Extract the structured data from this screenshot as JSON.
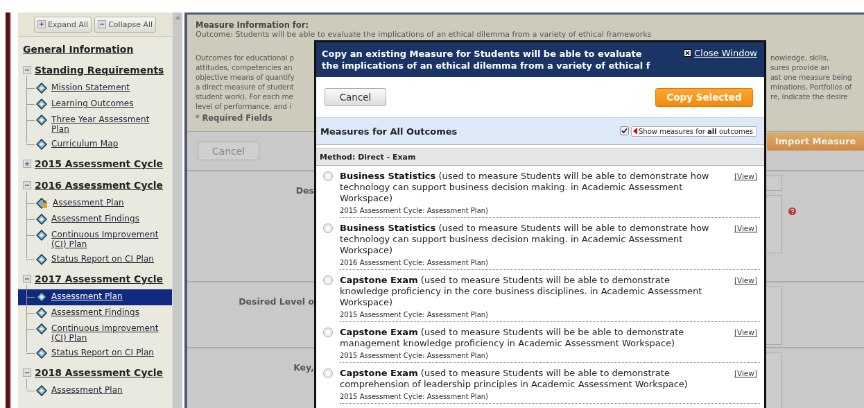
{
  "sidebar": {
    "buttons": [
      {
        "label": "Expand All",
        "kind": "expand"
      },
      {
        "label": "Collapse All",
        "kind": "collapse"
      }
    ],
    "items": [
      {
        "label": "General Information",
        "kind": "link"
      },
      {
        "label": "Standing Requirements",
        "kind": "group",
        "expanded": true,
        "children": [
          {
            "label": "Mission Statement",
            "locked": false,
            "selected": false
          },
          {
            "label": "Learning Outcomes",
            "locked": false,
            "selected": false
          },
          {
            "label": "Three Year Assessment Plan",
            "locked": false,
            "selected": false
          },
          {
            "label": "Curriculum Map",
            "locked": false,
            "selected": false
          }
        ]
      },
      {
        "label": "2015 Assessment Cycle",
        "kind": "group",
        "expanded": false
      },
      {
        "label": "2016 Assessment Cycle",
        "kind": "group",
        "expanded": true,
        "children": [
          {
            "label": "Assessment Plan",
            "locked": true,
            "selected": false
          },
          {
            "label": "Assessment Findings",
            "locked": false,
            "selected": false
          },
          {
            "label": "Continuous Improvement (CI) Plan",
            "locked": false,
            "selected": false
          },
          {
            "label": "Status Report on CI Plan",
            "locked": false,
            "selected": false
          }
        ]
      },
      {
        "label": "2017 Assessment Cycle",
        "kind": "group",
        "expanded": true,
        "children": [
          {
            "label": "Assessment Plan",
            "locked": false,
            "selected": true
          },
          {
            "label": "Assessment Findings",
            "locked": false,
            "selected": false
          },
          {
            "label": "Continuous Improvement (CI) Plan",
            "locked": false,
            "selected": false
          },
          {
            "label": "Status Report on CI Plan",
            "locked": false,
            "selected": false
          }
        ]
      },
      {
        "label": "2018 Assessment Cycle",
        "kind": "group",
        "expanded": true,
        "children": [
          {
            "label": "Assessment Plan",
            "locked": false,
            "selected": false
          }
        ]
      }
    ]
  },
  "main": {
    "heading": "Measure Information for:",
    "outcome": "Outcome: Students will be able to evaluate the implications of an ethical dilemma from a variety of ethical frameworks",
    "description_left": [
      "Outcomes for educational p",
      "attitudes, competencies an",
      "objective means of quantify",
      "a direct measure of student",
      "student work). For each me",
      "level of performance, and i"
    ],
    "description_right": [
      "nowledge, skills,",
      "sures provide an",
      "ast one measure being",
      "minations, Portfolios of",
      "re, indicate the desire"
    ],
    "required_note": "* **Required Fields**",
    "cancel_button": {
      "label": "Cancel",
      "disabled": true
    },
    "import_button": {
      "label": "Import Measure",
      "disabled": true
    },
    "form_rows": [
      {
        "label": "Des",
        "input": true,
        "help": true
      },
      {
        "label": "Desired Level o",
        "input": false,
        "help": false
      },
      {
        "label": "Key,",
        "input": false,
        "help": false
      }
    ]
  },
  "modal": {
    "title": "Copy an existing Measure for Students will be able to evaluate the implications of an ethical dilemma from a variety of ethical f",
    "close_label": "Close Window",
    "cancel_label": "Cancel",
    "copy_label": "Copy Selected",
    "section_title": "Measures for All Outcomes",
    "show_all": {
      "label": "Show measures for **all** outcomes",
      "checked": true
    },
    "method": "Method: Direct - Exam",
    "measures": [
      {
        "text": "**Business Statistics** (used to measure Students will be able to demonstrate how technology can support business decision making. in Academic Assessment Workspace)",
        "source": "2015 Assessment Cycle: Assessment Plan)",
        "view": "[View]",
        "selected": false
      },
      {
        "text": "**Business Statistics** (used to measure Students will be able to demonstrate how technology can support business decision making. in Academic Assessment Workspace)",
        "source": "2016 Assessment Cycle: Assessment Plan)",
        "view": "[View]",
        "selected": false
      },
      {
        "text": "**Capstone Exam** (used to measure Students will be able to demonstrate knowledge proficiency in the core business disciplines. in Academic Assessment Workspace)",
        "source": "2015 Assessment Cycle: Assessment Plan)",
        "view": "[View]",
        "selected": false
      },
      {
        "text": "**Capstone Exam** (used to measure Students will be be able to demonstrate management knowledge proficiency in Academic Assessment Workspace)",
        "source": "2015 Assessment Cycle: Assessment Plan)",
        "view": "[View]",
        "selected": false
      },
      {
        "text": "**Capstone Exam** (used to measure Students will be able to demonstrate comprehension of leadership principles in Academic Assessment Workspace)",
        "source": "2015 Assessment Cycle: Assessment Plan)",
        "view": "[View]",
        "selected": false
      }
    ]
  }
}
